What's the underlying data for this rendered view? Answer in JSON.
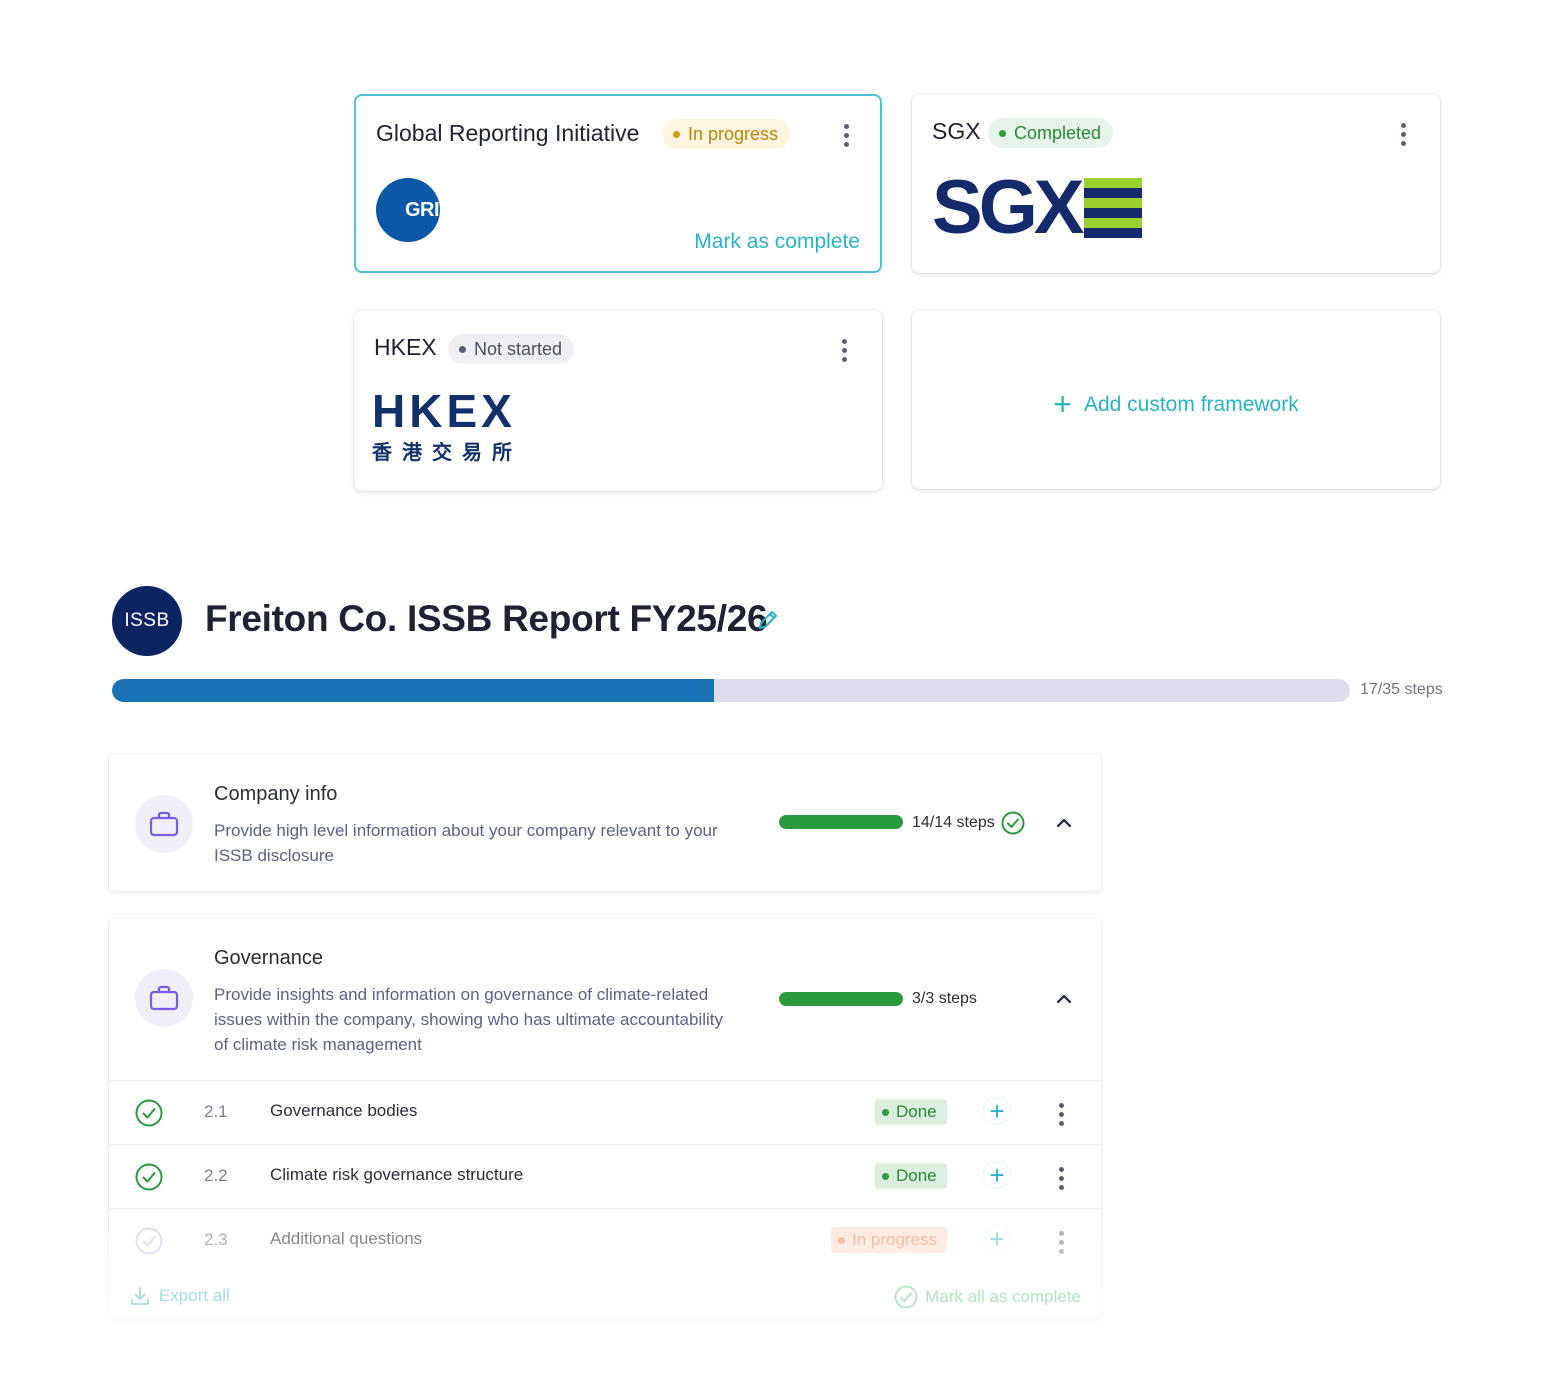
{
  "frameworks": {
    "gri": {
      "title": "Global Reporting Initiative",
      "status": "In progress",
      "logo_text": "GRI",
      "action": "Mark as complete"
    },
    "sgx": {
      "title": "SGX",
      "status": "Completed",
      "logo_text": "SGX"
    },
    "hkex": {
      "title": "HKEX",
      "status": "Not started",
      "logo_text": "HKEX",
      "logo_subtext": "香港交易所"
    },
    "add_custom": {
      "label": "Add custom framework"
    }
  },
  "colors": {
    "accent": "#2ab3c5",
    "in_progress": "#d39a12",
    "completed": "#2a9a3d",
    "not_started": "#5a6072",
    "brand_navy": "#0d2463",
    "progress_blue": "#1b72b5"
  },
  "report": {
    "badge": "ISSB",
    "title": "Freiton Co. ISSB Report FY25/26",
    "steps_text": "17/35 steps",
    "progress": 0.486
  },
  "sections": [
    {
      "title": "Company info",
      "description": "Provide high level information about your company relevant to your ISSB disclosure",
      "steps_text": "14/14 steps",
      "progress": 1.0,
      "icon": "briefcase-icon"
    },
    {
      "title": "Governance",
      "description": "Provide insights and information on governance of climate-related issues within the company, showing who has ultimate accountability of climate risk management",
      "steps_text": "3/3 steps",
      "progress": 1.0,
      "icon": "briefcase-icon",
      "items": [
        {
          "number": "2.1",
          "label": "Governance bodies",
          "status": "Done"
        },
        {
          "number": "2.2",
          "label": "Climate risk governance structure",
          "status": "Done"
        },
        {
          "number": "2.3",
          "label": "Additional questions",
          "status": "In progress"
        }
      ]
    }
  ],
  "footer": {
    "export_label": "Export all",
    "mark_all_label": "Mark all as complete"
  }
}
